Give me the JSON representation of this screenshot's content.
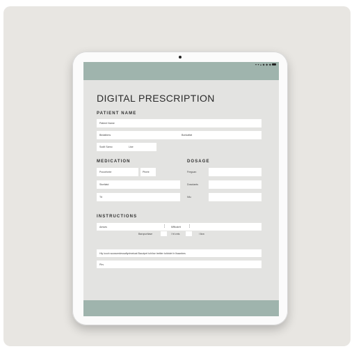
{
  "status_bar": {
    "text": "▾ ▾ ▴ ◆ ◆ ◆"
  },
  "form": {
    "title": "DIGITAL PRESCRIPTION",
    "patient": {
      "heading": "PATIENT NAME",
      "name_label": "Patient Name",
      "birth_label": "Birdatbms",
      "number_label": "Bonkatfat",
      "social_label": "Sodit Samo",
      "date_label": "Lise"
    },
    "medication": {
      "heading": "MEDICATION",
      "field1_label": "Pocorfonte",
      "field2_label": "Pforte",
      "field3_label": "Stortlatd",
      "field4_label": "Tit"
    },
    "dosage": {
      "heading": "DOSAGE",
      "row1_label": "Freguan",
      "row2_label": "Dosolants",
      "row3_label": "Nfu"
    },
    "instructions": {
      "heading": "INSTRUCTIONS",
      "field1_label": "Amses",
      "field1_sep": "¦",
      "field1_mid_label": "Mffkokrtt",
      "field1_sep2": "¦",
      "option1_label": "Barcpurtiase",
      "option2_label": "l ht cnts",
      "option3_label": "l llcw",
      "note_text": "Hiy iccoh soosserdessaftyrimetoat Bacvipet tch/ise treitter tohbdet tr Ihaanbes",
      "field3_label": "Plrv"
    }
  }
}
